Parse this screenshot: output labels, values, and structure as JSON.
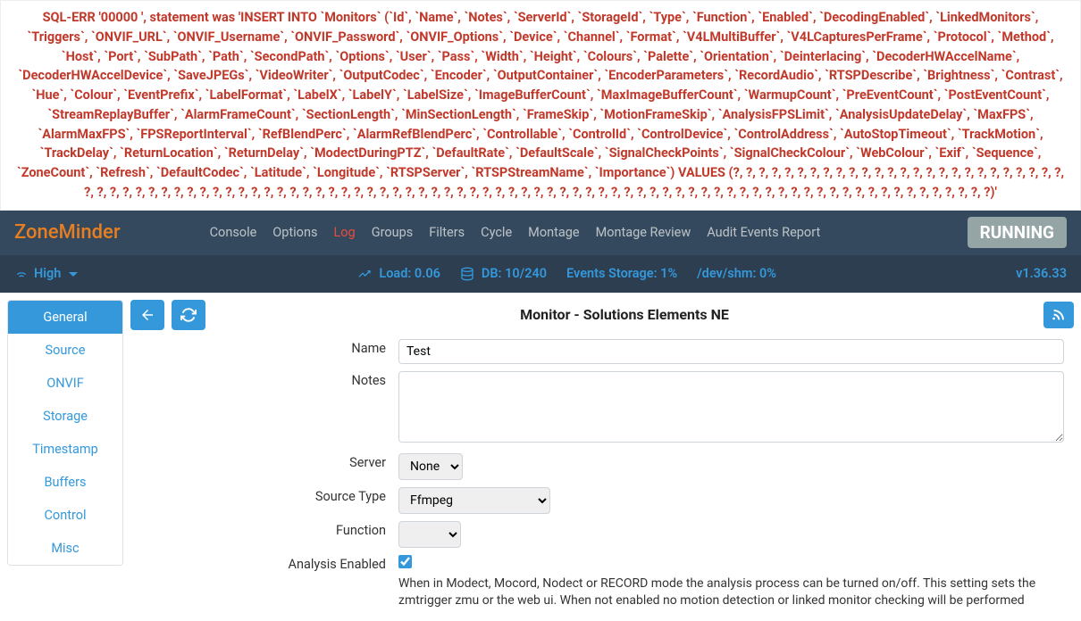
{
  "error": "SQL-ERR '00000 ', statement was 'INSERT INTO `Monitors` (`Id`, `Name`, `Notes`, `ServerId`, `StorageId`, `Type`, `Function`, `Enabled`, `DecodingEnabled`, `LinkedMonitors`, `Triggers`, `ONVIF_URL`, `ONVIF_Username`, `ONVIF_Password`, `ONVIF_Options`, `Device`, `Channel`, `Format`, `V4LMultiBuffer`, `V4LCapturesPerFrame`, `Protocol`, `Method`, `Host`, `Port`, `SubPath`, `Path`, `SecondPath`, `Options`, `User`, `Pass`, `Width`, `Height`, `Colours`, `Palette`, `Orientation`, `Deinterlacing`, `DecoderHWAccelName`, `DecoderHWAccelDevice`, `SaveJPEGs`, `VideoWriter`, `OutputCodec`, `Encoder`, `OutputContainer`, `EncoderParameters`, `RecordAudio`, `RTSPDescribe`, `Brightness`, `Contrast`, `Hue`, `Colour`, `EventPrefix`, `LabelFormat`, `LabelX`, `LabelY`, `LabelSize`, `ImageBufferCount`, `MaxImageBufferCount`, `WarmupCount`, `PreEventCount`, `PostEventCount`, `StreamReplayBuffer`, `AlarmFrameCount`, `SectionLength`, `MinSectionLength`, `FrameSkip`, `MotionFrameSkip`, `AnalysisFPSLimit`, `AnalysisUpdateDelay`, `MaxFPS`, `AlarmMaxFPS`, `FPSReportInterval`, `RefBlendPerc`, `AlarmRefBlendPerc`, `Controllable`, `ControlId`, `ControlDevice`, `ControlAddress`, `AutoStopTimeout`, `TrackMotion`, `TrackDelay`, `ReturnLocation`, `ReturnDelay`, `ModectDuringPTZ`, `DefaultRate`, `DefaultScale`, `SignalCheckPoints`, `SignalCheckColour`, `WebColour`, `Exif`, `Sequence`, `ZoneCount`, `Refresh`, `DefaultCodec`, `Latitude`, `Longitude`, `RTSPServer`, `RTSPStreamName`, `Importance`) VALUES (?, ?, ?, ?, ?, ?, ?, ?, ?, ?, ?, ?, ?, ?, ?, ?, ?, ?, ?, ?, ?, ?, ?, ?, ?, ?, ?, ?, ?, ?, ?, ?, ?, ?, ?, ?, ?, ?, ?, ?, ?, ?, ?, ?, ?, ?, ?, ?, ?, ?, ?, ?, ?, ?, ?, ?, ?, ?, ?, ?, ?, ?, ?, ?, ?, ?, ?, ?, ?, ?, ?, ?, ?, ?, ?, ?, ?, ?, ?, ?, ?, ?, ?, ?, ?, ?, ?, ?, ?, ?, ?, ?, ?, ?, ?, ?, ?)'",
  "brand": "ZoneMinder",
  "nav": {
    "console": "Console",
    "options": "Options",
    "log": "Log",
    "groups": "Groups",
    "filters": "Filters",
    "cycle": "Cycle",
    "montage": "Montage",
    "montageReview": "Montage Review",
    "auditEventsReport": "Audit Events Report"
  },
  "running": "RUNNING",
  "status": {
    "bandwidth": "High",
    "load": "Load: 0.06",
    "db": "DB: 10/240",
    "eventsStorage": "Events Storage: 1%",
    "shm": "/dev/shm: 0%",
    "version": "v1.36.33"
  },
  "tabs": [
    "General",
    "Source",
    "ONVIF",
    "Storage",
    "Timestamp",
    "Buffers",
    "Control",
    "Misc"
  ],
  "pageTitle": "Monitor - Solutions Elements NE",
  "form": {
    "labels": {
      "name": "Name",
      "notes": "Notes",
      "server": "Server",
      "sourceType": "Source Type",
      "function": "Function",
      "analysisEnabled": "Analysis Enabled"
    },
    "values": {
      "name": "Test",
      "notes": "",
      "server": "None",
      "sourceType": "Ffmpeg",
      "function": "",
      "analysisEnabled": true
    },
    "help": {
      "analysisEnabled": "When in Modect, Mocord, Nodect or RECORD mode the analysis process can be turned on/off. This setting sets the zmtrigger zmu or the web ui. When not enabled no motion detection or linked monitor checking will be performed"
    }
  }
}
